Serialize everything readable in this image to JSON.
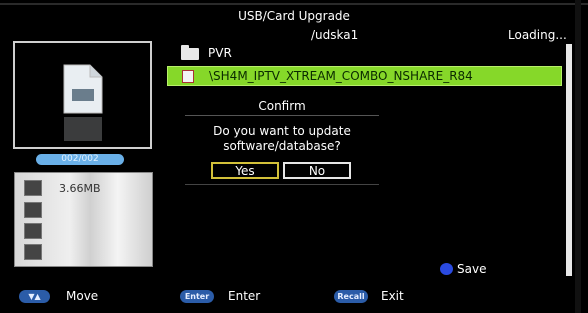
{
  "header": {
    "title": "USB/Card Upgrade",
    "path": "/udska1",
    "status": "Loading..."
  },
  "preview": {
    "counter": "002/002",
    "size": "3.66MB"
  },
  "file_list": [
    {
      "icon": "folder-icon",
      "name": "PVR",
      "selected": false
    },
    {
      "icon": "file-icon",
      "name": "\\SH4M_IPTV_XTREAM_COMBO_NSHARE_R84",
      "selected": true
    }
  ],
  "dialog": {
    "title": "Confirm",
    "message_line1": "Do you want to update",
    "message_line2": "software/database?",
    "yes_label": "Yes",
    "no_label": "No"
  },
  "footer": {
    "save_label": "Save",
    "move_key": "▼▲",
    "move_label": "Move",
    "enter_key": "Enter",
    "enter_label": "Enter",
    "recall_key": "Recall",
    "exit_label": "Exit"
  },
  "colors": {
    "selection": "#86d829",
    "yes_border": "#d4c23a",
    "key_bg": "#2b5ca8",
    "save_dot": "#2a4ae0",
    "counter_bg": "#6ab0e8"
  }
}
